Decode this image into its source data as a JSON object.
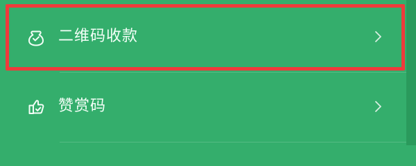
{
  "menu": {
    "items": [
      {
        "label": "二维码收款",
        "icon": "money-bag-icon",
        "chevron": "chevron-right-icon",
        "highlighted": true
      },
      {
        "label": "赞赏码",
        "icon": "thumbs-up-icon",
        "chevron": "chevron-right-icon",
        "highlighted": false
      }
    ]
  },
  "colors": {
    "background": "#34ae6c",
    "highlight_border": "#ef3b3b",
    "text": "#f3fff7",
    "chevron": "#d8efe1"
  }
}
